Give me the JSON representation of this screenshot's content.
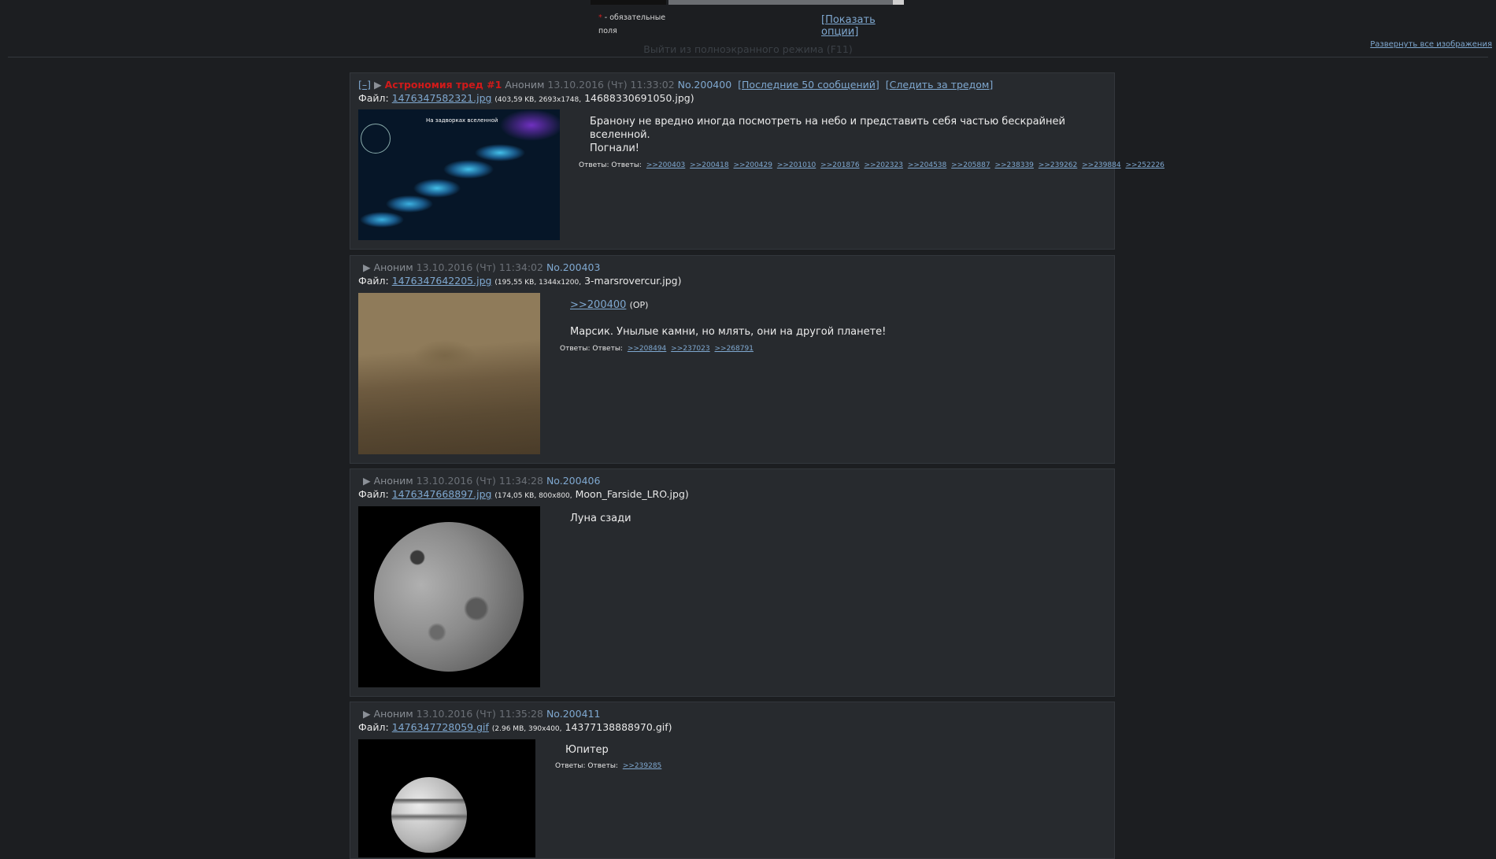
{
  "form": {
    "required_star": "*",
    "required_note": "- обязательные поля",
    "show_options": "[Показать опции]"
  },
  "fullscreen_exit": "Выйти из полноэкранного режима (F11)",
  "expand_all": "Развернуть все изображения",
  "posts": [
    {
      "hide": "[–]",
      "subject": "Астрономия тред #1",
      "name": "Аноним",
      "date": "13.10.2016 (Чт) 11:33:02",
      "number": "No.200400",
      "last50": "[Последние 50 сообщений]",
      "follow": "[Следить за тредом]",
      "file_label": "Файл:",
      "file_link": "1476347582321.jpg",
      "file_meta": "(403,59 KB, 2693x1748,",
      "file_orig": "14688330691050.jpg)",
      "thumb_title": "На задворках вселенной",
      "paragraphs": [
        "Бранону не вредно иногда посмотреть на небо и представить себя частью бескрайней вселенной.",
        "Погнали!"
      ],
      "replies_label": "Ответы: Ответы:",
      "replies": [
        ">>200403",
        ">>200418",
        ">>200429",
        ">>201010",
        ">>201876",
        ">>202323",
        ">>204538",
        ">>205887",
        ">>238339",
        ">>239262",
        ">>239884",
        ">>252226"
      ]
    },
    {
      "name": "Аноним",
      "date": "13.10.2016 (Чт) 11:34:02",
      "number": "No.200403",
      "file_label": "Файл:",
      "file_link": "1476347642205.jpg",
      "file_meta": "(195,55 KB, 1344x1200,",
      "file_orig": "3-marsrovercur.jpg)",
      "quote_link": ">>200400",
      "quote_op": "(OP)",
      "paragraphs": [
        "Марсик. Унылые камни, но млять, они на другой планете!"
      ],
      "replies_label": "Ответы: Ответы:",
      "replies": [
        ">>208494",
        ">>237023",
        ">>268791"
      ]
    },
    {
      "name": "Аноним",
      "date": "13.10.2016 (Чт) 11:34:28",
      "number": "No.200406",
      "file_label": "Файл:",
      "file_link": "1476347668897.jpg",
      "file_meta": "(174,05 KB, 800x800,",
      "file_orig": "Moon_Farside_LRO.jpg)",
      "paragraphs": [
        "Луна сзади"
      ]
    },
    {
      "name": "Аноним",
      "date": "13.10.2016 (Чт) 11:35:28",
      "number": "No.200411",
      "file_label": "Файл:",
      "file_link": "1476347728059.gif",
      "file_meta": "(2.96 MB, 390x400,",
      "file_orig": "14377138888970.gif)",
      "paragraphs": [
        "Юпитер"
      ],
      "replies_label": "Ответы: Ответы:",
      "replies": [
        ">>239285"
      ]
    }
  ]
}
